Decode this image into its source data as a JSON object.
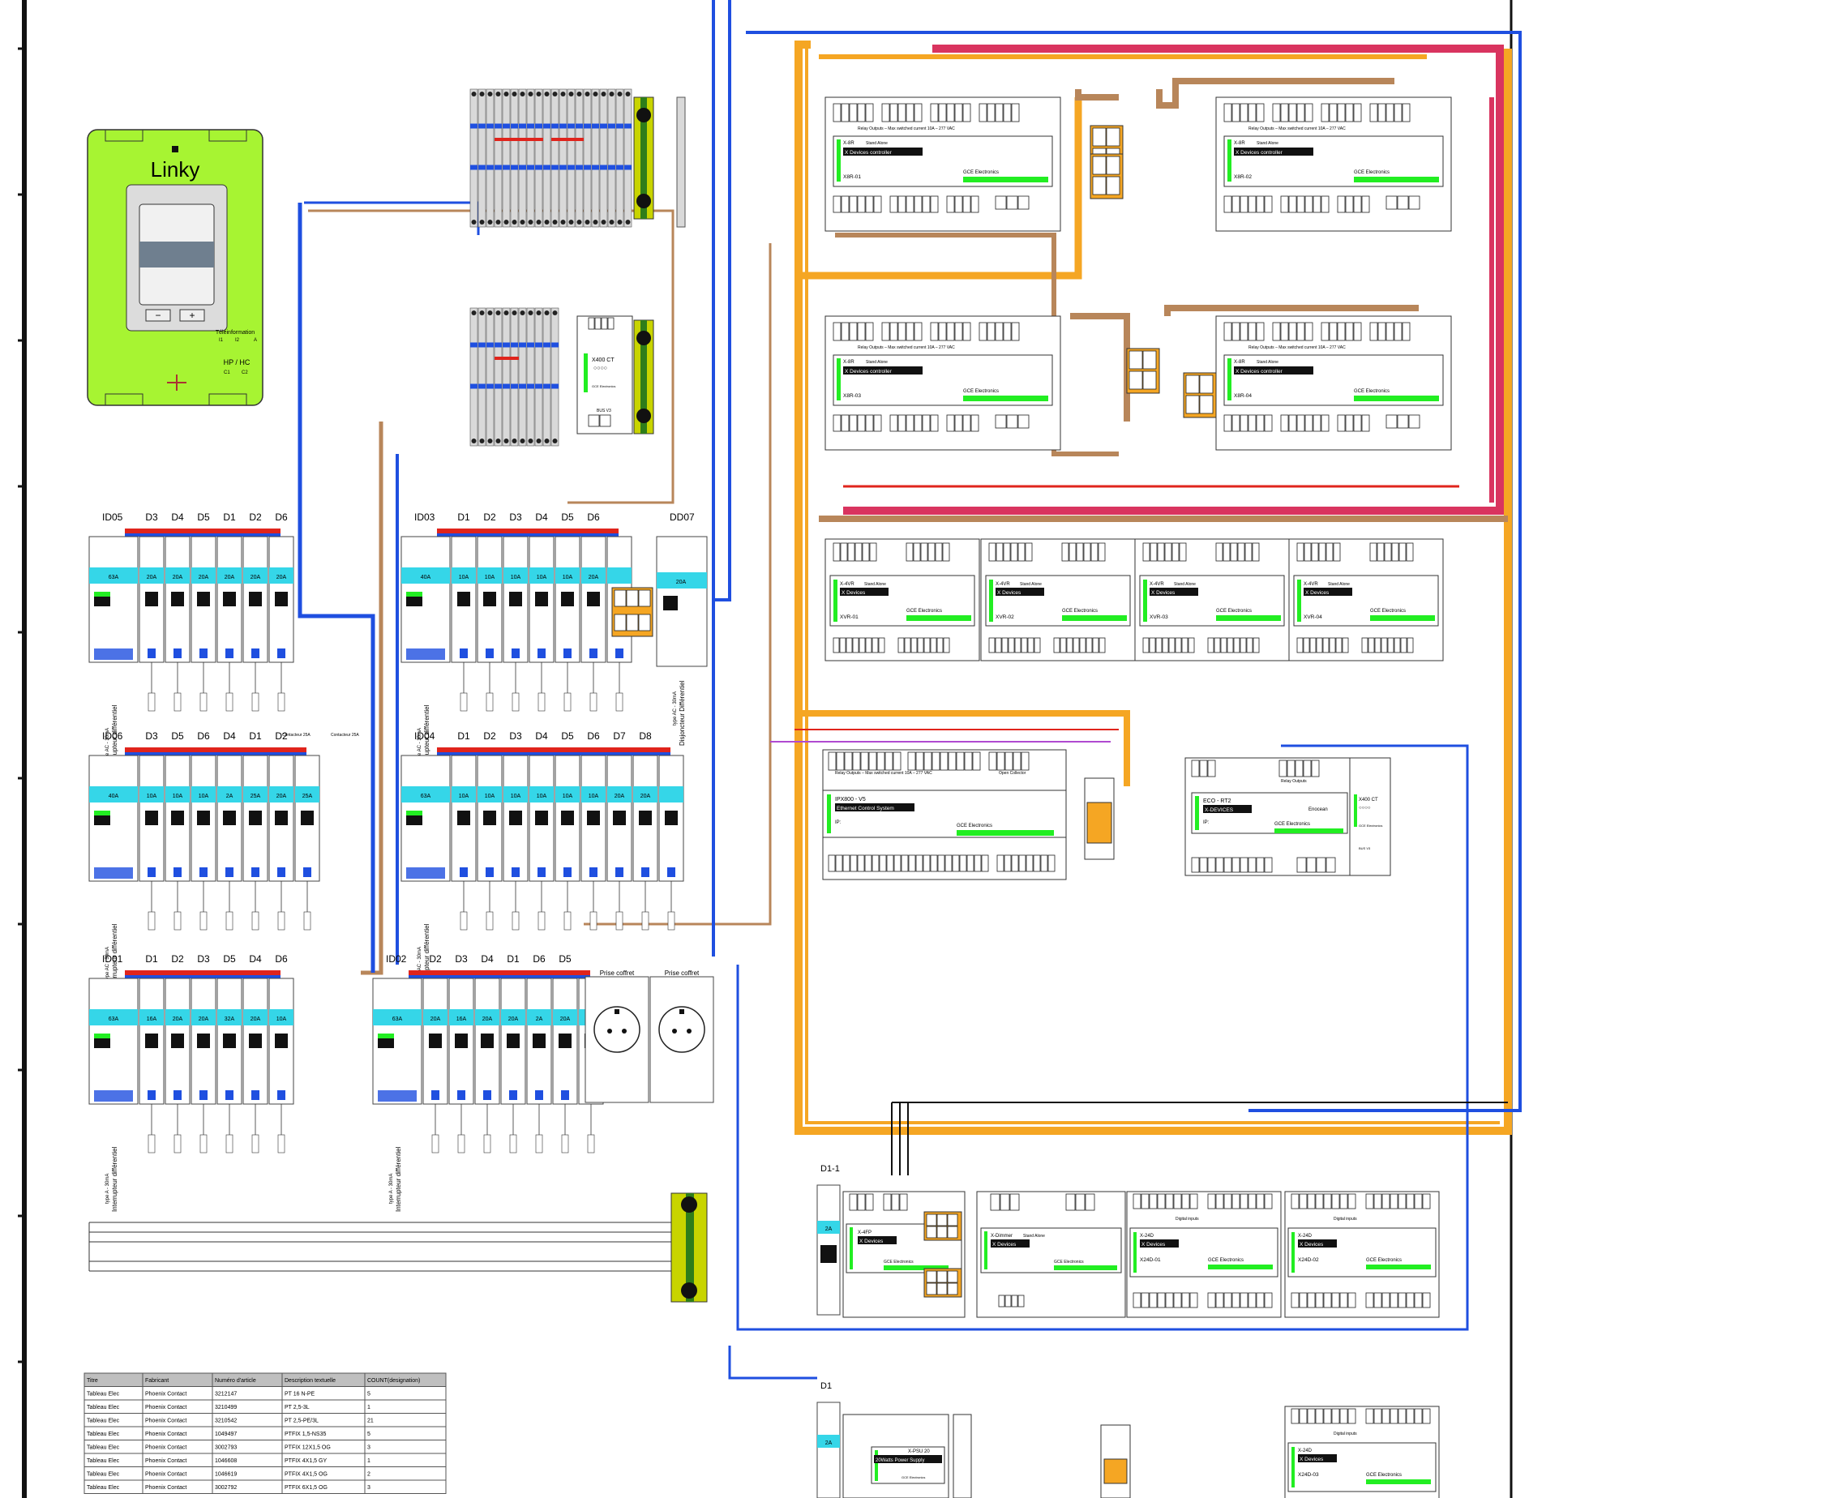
{
  "linky": {
    "title": "Linky",
    "teleinfo_label": "Téléinformation",
    "teleinfo_pins": [
      "I1",
      "I2",
      "A"
    ],
    "hphc_label": "HP / HC",
    "hphc_pins": [
      "C1",
      "C2"
    ],
    "btn_minus": "−",
    "btn_plus": "+"
  },
  "panels": [
    {
      "id": "ID05",
      "breakers": [
        "D3",
        "D4",
        "D5",
        "D1",
        "D2",
        "D6"
      ],
      "main_rating": "63A",
      "ratings": [
        "20A",
        "20A",
        "20A",
        "20A",
        "20A",
        "20A"
      ],
      "caption": "Interrupteur différentiel",
      "type": "type AC - 30mA"
    },
    {
      "id": "ID03",
      "breakers": [
        "D1",
        "D2",
        "D3",
        "D4",
        "D5",
        "D6"
      ],
      "main_rating": "40A",
      "ratings": [
        "10A",
        "10A",
        "10A",
        "10A",
        "10A",
        "20A"
      ],
      "caption": "Interrupteur différentiel",
      "type": "type AC - 30mA"
    },
    {
      "id": "DD07",
      "breakers": [],
      "main_rating": "20A",
      "ratings": [],
      "caption": "Disjoncteur Différentiel",
      "type": "type AC - 30mA"
    },
    {
      "id": "ID06",
      "breakers": [
        "D3",
        "D5",
        "D6",
        "D4",
        "D1",
        "D2"
      ],
      "main_rating": "40A",
      "ratings": [
        "10A",
        "10A",
        "10A",
        "2A",
        "25A",
        "20A",
        "25A"
      ],
      "caption": "Interrupteur différentiel",
      "type": "type AC - 30mA",
      "extra": [
        "Contacteur 25A",
        "Contacteur 25A"
      ]
    },
    {
      "id": "ID04",
      "breakers": [
        "D1",
        "D2",
        "D3",
        "D4",
        "D5",
        "D6",
        "D7",
        "D8"
      ],
      "main_rating": "63A",
      "ratings": [
        "10A",
        "10A",
        "10A",
        "10A",
        "10A",
        "10A",
        "20A",
        "20A"
      ],
      "caption": "Interrupteur différentiel",
      "type": "type AC - 30mA"
    },
    {
      "id": "ID01",
      "breakers": [
        "D1",
        "D2",
        "D3",
        "D5",
        "D4",
        "D6"
      ],
      "main_rating": "63A",
      "ratings": [
        "16A",
        "20A",
        "20A",
        "32A",
        "20A",
        "10A"
      ],
      "caption": "Interrupteur différentiel",
      "type": "type A - 30mA"
    },
    {
      "id": "ID02",
      "breakers": [
        "D2",
        "D3",
        "D4",
        "D1",
        "D6",
        "D5"
      ],
      "main_rating": "63A",
      "ratings": [
        "20A",
        "16A",
        "20A",
        "20A",
        "2A",
        "20A"
      ],
      "caption": "Interrupteur différentiel",
      "type": "type A - 30mA"
    }
  ],
  "sockets": [
    "Prise coffret",
    "Prise coffret"
  ],
  "controllers": {
    "x8r": [
      {
        "name": "X8R-01",
        "model": "X-8R",
        "mode": "Stand Alone",
        "desc": "X Devices controller",
        "brand": "GCE Electronics",
        "relay_label": "Relay Outputs – Max switched current 10A – 277 VAC"
      },
      {
        "name": "X8R-02",
        "model": "X-8R",
        "mode": "Stand Alone",
        "desc": "X Devices controller",
        "brand": "GCE Electronics",
        "relay_label": "Relay Outputs – Max switched current 10A – 277 VAC"
      },
      {
        "name": "X8R-03",
        "model": "X-8R",
        "mode": "Stand Alone",
        "desc": "X Devices controller",
        "brand": "GCE Electronics",
        "relay_label": "Relay Outputs – Max switched current 10A – 277 VAC"
      },
      {
        "name": "X8R-04",
        "model": "X-8R",
        "mode": "Stand Alone",
        "desc": "X Devices controller",
        "brand": "GCE Electronics",
        "relay_label": "Relay Outputs – Max switched current 10A – 277 VAC"
      }
    ],
    "xvr": [
      {
        "name": "XVR-01",
        "model": "X-4VR",
        "mode": "Stand Alone",
        "desc": "X Devices",
        "brand": "GCE Electronics"
      },
      {
        "name": "XVR-02",
        "model": "X-4VR",
        "mode": "Stand Alone",
        "desc": "X Devices",
        "brand": "GCE Electronics"
      },
      {
        "name": "XVR-03",
        "model": "X-4VR",
        "mode": "Stand Alone",
        "desc": "X Devices",
        "brand": "GCE Electronics"
      },
      {
        "name": "XVR-04",
        "model": "X-4VR",
        "mode": "Stand Alone",
        "desc": "X Devices",
        "brand": "GCE Electronics"
      }
    ],
    "ipx": {
      "name": "IPX800 - V5",
      "desc": "Ethernet Control System",
      "brand": "GCE Electronics",
      "ip_label": "IP:",
      "relay_label": "Relay Outputs – Max switched current 10A – 277 VAC",
      "oc_label": "Open Collector"
    },
    "eco": {
      "name": "ECO - RT2",
      "desc": "X-DEVICES",
      "brand": "GCE Electronics",
      "ip_label": "IP:",
      "enocean": "Enocean",
      "relay_label": "Relay Outputs"
    },
    "x400_right": {
      "name": "X400 CT",
      "brand": "GCE Electronics",
      "bus": "BUS V3"
    },
    "x400_left": {
      "name": "X400 CT",
      "brand": "GCE Electronics",
      "bus": "BUS V3"
    },
    "x4fp": {
      "name": "X-4FP",
      "desc": "X Devices",
      "brand": "GCE Electronics"
    },
    "xdimmer": {
      "name": "X-Dimmer",
      "mode": "Stand Alone",
      "desc": "X Devices",
      "brand": "GCE Electronics"
    },
    "x24d": [
      {
        "name": "X24D-01",
        "model": "X-24D",
        "desc": "X Devices",
        "brand": "GCE Electronics",
        "inputs": "Digital inputs"
      },
      {
        "name": "X24D-02",
        "model": "X-24D",
        "desc": "X Devices",
        "brand": "GCE Electronics",
        "inputs": "Digital inputs"
      },
      {
        "name": "X24D-03",
        "model": "X-24D",
        "desc": "X Devices",
        "brand": "GCE Electronics",
        "inputs": "Digital inputs"
      }
    ],
    "xpsu": {
      "name": "X-PSU 20",
      "desc": "20Watts Power Supply",
      "brand": "GCE Electronics"
    }
  },
  "breaker_labels": {
    "d1_1": "D1-1",
    "d1": "D1",
    "d1_rating": "2A"
  },
  "ground_bar_label": "",
  "table": {
    "headers": [
      "Titre",
      "Fabricant",
      "Numéro d'article",
      "Description textuelle",
      "COUNT(designation)"
    ],
    "rows": [
      [
        "Tableau Elec",
        "Phoenix Contact",
        "3212147",
        "PT 16 N-PE",
        "5"
      ],
      [
        "Tableau Elec",
        "Phoenix Contact",
        "3210499",
        "PT 2,5-3L",
        "1"
      ],
      [
        "Tableau Elec",
        "Phoenix Contact",
        "3210542",
        "PT 2,5-PE/3L",
        "21"
      ],
      [
        "Tableau Elec",
        "Phoenix Contact",
        "1049497",
        "PTFIX 1,5-NS35",
        "5"
      ],
      [
        "Tableau Elec",
        "Phoenix Contact",
        "3002793",
        "PTFIX 12X1,5 OG",
        "3"
      ],
      [
        "Tableau Elec",
        "Phoenix Contact",
        "1046608",
        "PTFIX 4X1,5 GY",
        "1"
      ],
      [
        "Tableau Elec",
        "Phoenix Contact",
        "1046619",
        "PTFIX 4X1,5 OG",
        "2"
      ],
      [
        "Tableau Elec",
        "Phoenix Contact",
        "3002792",
        "PTFIX 6X1,5 OG",
        "3"
      ]
    ]
  },
  "colors": {
    "linky_green": "#a7f432",
    "wire_orange": "#f5a623",
    "wire_brown": "#b8865a",
    "wire_blue": "#1f4fe0",
    "wire_pink": "#d9345f",
    "wire_red": "#e0241c",
    "breaker_cyan": "#35d6e8",
    "status_green": "#22ee22",
    "ground_yellow": "#c8d400",
    "ground_green": "#2e7d1a"
  }
}
